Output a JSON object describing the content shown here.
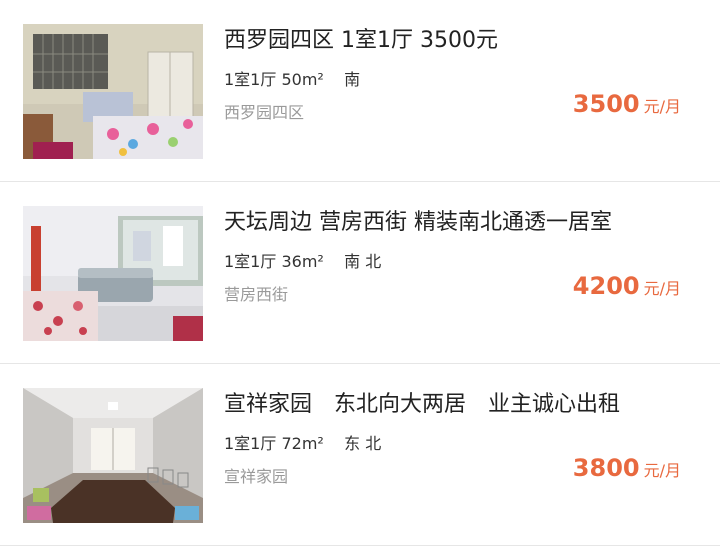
{
  "listings": [
    {
      "title": "西罗园四区 1室1厅 3500元",
      "layout": "1室1厅",
      "size": "50m²",
      "orientation": "南",
      "area": "西罗园四区",
      "price": "3500",
      "price_unit": "元/月",
      "photo_icon": "bedroom-photo"
    },
    {
      "title": "天坛周边 营房西街 精装南北通透一居室",
      "layout": "1室1厅",
      "size": "36m²",
      "orientation": "南 北",
      "area": "营房西街",
      "price": "4200",
      "price_unit": "元/月",
      "photo_icon": "living-room-photo"
    },
    {
      "title": "宣祥家园　东北向大两居　业主诚心出租",
      "layout": "1室1厅",
      "size": "72m²",
      "orientation": "东 北",
      "area": "宣祥家园",
      "price": "3800",
      "price_unit": "元/月",
      "photo_icon": "empty-room-photo"
    }
  ],
  "colors": {
    "price": "#e8693f",
    "title": "#222222",
    "meta": "#333333",
    "area": "#9a9a9a",
    "divider": "#e6e6e6"
  }
}
